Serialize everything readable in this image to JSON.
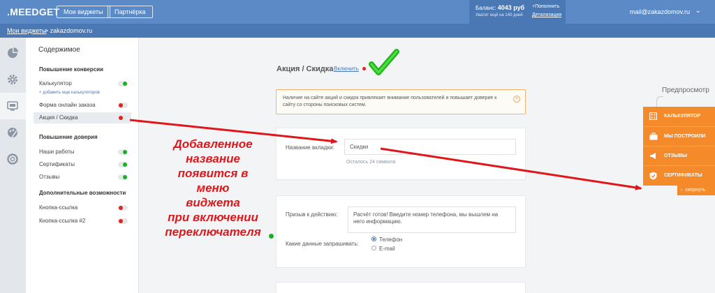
{
  "header": {
    "logo": ".MEEDGET",
    "my_widgets_btn": "Мои виджеты",
    "partners_btn": "Партнёрка",
    "balance_label": "Баланс:",
    "balance_value": "4043 руб",
    "balance_note": "Хватит ещё на 140 дней",
    "topup_link": "+Пополнить",
    "details_link": "Детализация",
    "user_email": "mail@zakazdomov.ru"
  },
  "breadcrumb": {
    "root": "Мои виджеты",
    "separator_current": "> zakazdomov.ru"
  },
  "rail": {
    "icons": [
      "pie-chart-icon",
      "gear-icon",
      "monitor-icon",
      "palette-icon",
      "lifebuoy-icon"
    ]
  },
  "menu": {
    "title": "Содержимое",
    "section_conversion": "Повышение конверсии",
    "item_calculator": "Калькулятор",
    "add_calculators": "+ добавить еще калькуляторов",
    "item_order_form": "Форма онлайн заказа",
    "item_promo": "Акция / Скидка",
    "section_trust": "Повышение доверия",
    "item_works": "Наши работы",
    "item_certificates": "Сертификаты",
    "item_reviews": "Отзывы",
    "section_extra": "Дополнительные возможности",
    "item_link_button": "Кнопка-ссылка",
    "item_link_button2": "Кнопка-ссылка #2",
    "toggles": {
      "calculator": "on",
      "order_form": "off",
      "promo": "off",
      "works": "on",
      "certificates": "on",
      "reviews": "on",
      "link_button": "off",
      "link_button2": "off"
    }
  },
  "main": {
    "title": "Акция / Скидка",
    "enable_link": "Включить",
    "notice": "Наличие на сайте акций и скидок привлекает внимание пользователей и повышает доверие к сайту со стороны поисковых систем.",
    "tab_name_label": "Название вкладки:",
    "tab_name_value": "Скидки",
    "tab_name_hint": "Осталось 24 символа",
    "cta_label": "Призыв к действию:",
    "cta_value": "Расчёт готов! Введите номер телефона, мы вышлем на него информацию.",
    "request_label": "Какие данные запрашивать:",
    "option_phone": "Телефон",
    "option_email": "E-mail",
    "selected_option": "Телефон"
  },
  "annotation": {
    "line1": "Добавленное",
    "line2": "название",
    "line3": "появится в",
    "line4": "меню",
    "line5": "виджета",
    "line6": "при включении",
    "line7": "переключателя"
  },
  "preview": {
    "label": "Предпросмотр",
    "items": [
      "КАЛЬКУЛЯТОР",
      "МЫ ПОСТРОИЛИ",
      "ОТЗЫВЫ",
      "СЕРТИФИКАТЫ"
    ],
    "collapse": "свернуть"
  },
  "colors": {
    "header_blue": "#5b8ac7",
    "dark_blue": "#4a78b5",
    "accent_orange": "#f58a2b",
    "annotation_red": "#e0161a",
    "toggle_on": "#1bb024",
    "toggle_off": "#e2231a"
  }
}
